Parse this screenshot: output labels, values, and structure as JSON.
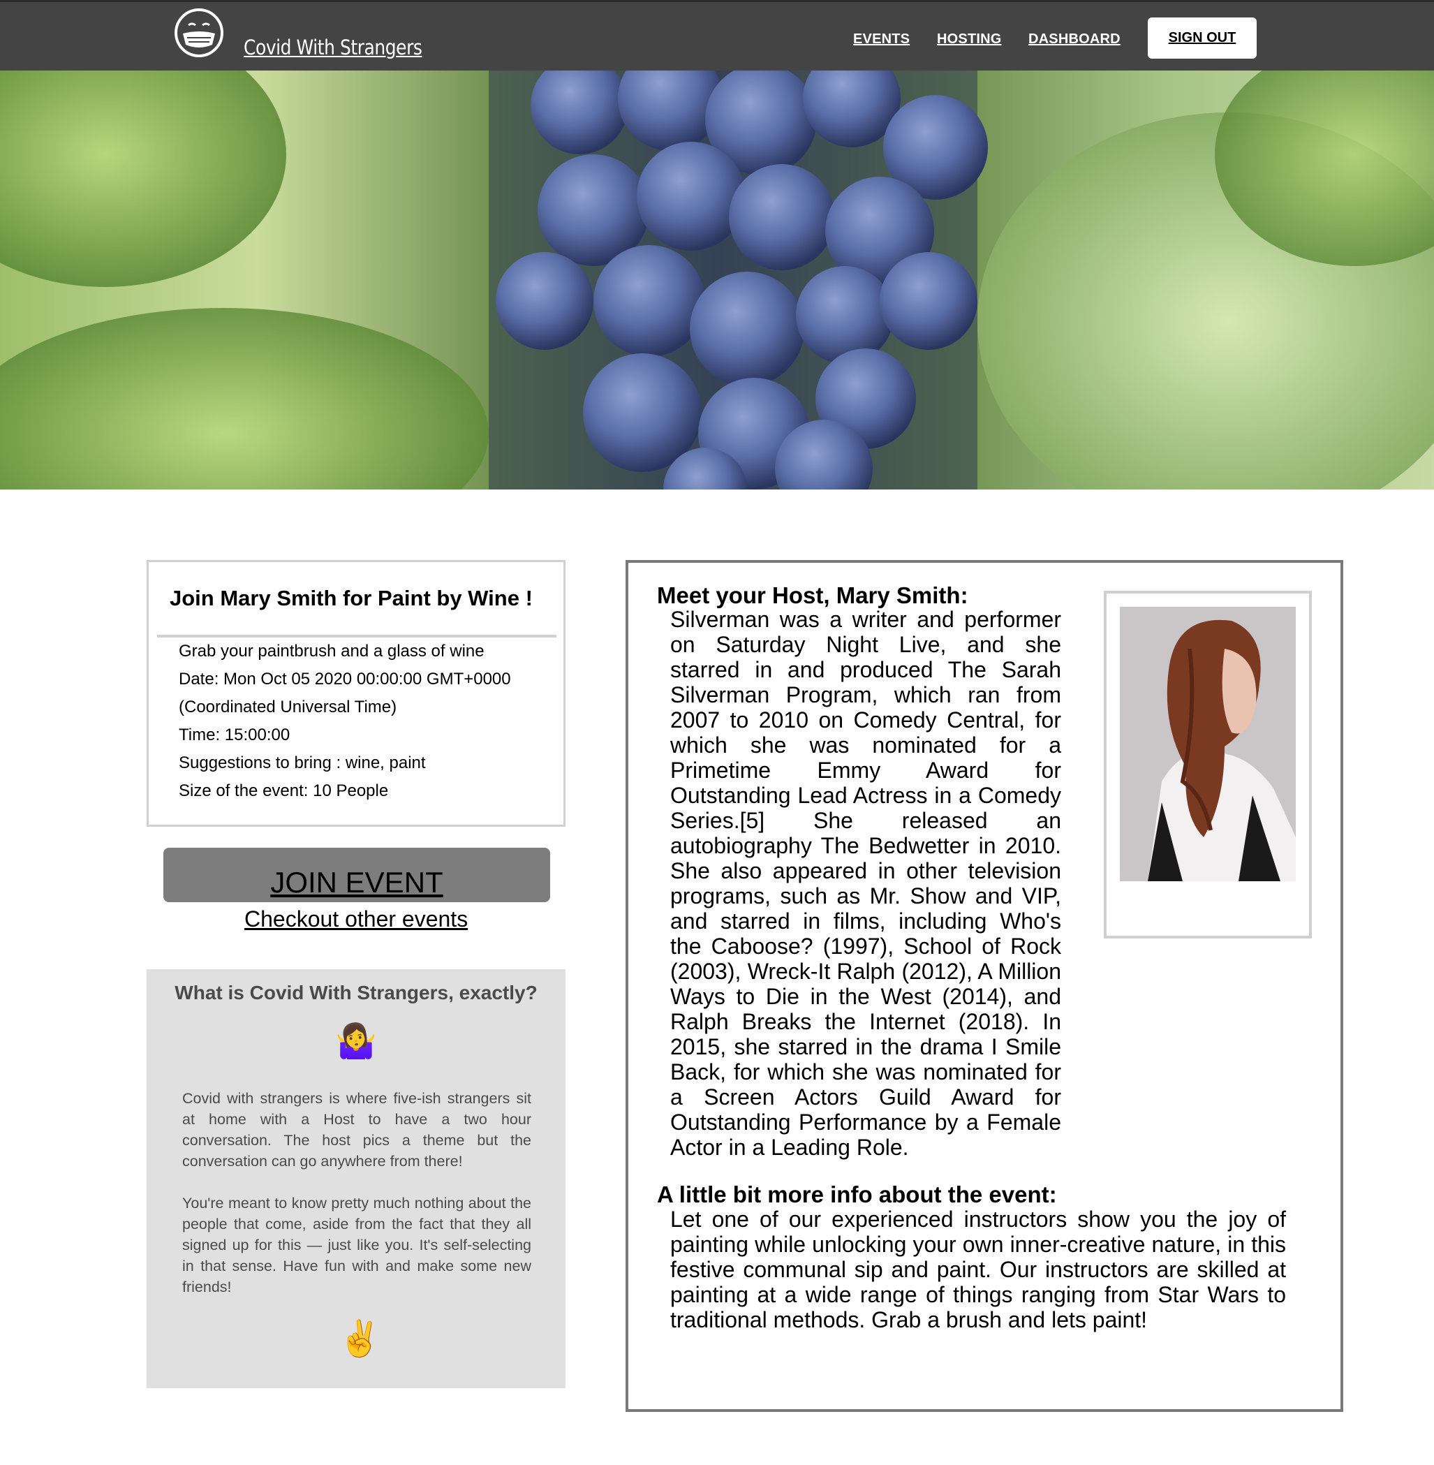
{
  "nav": {
    "brand": "Covid With Strangers",
    "links": [
      "EVENTS",
      "HOSTING",
      "DASHBOARD"
    ],
    "signout": "SIGN OUT"
  },
  "event": {
    "title": "Join Mary Smith for Paint by Wine !",
    "description": "Grab your paintbrush and a glass of wine",
    "date_line1": "Date: Mon Oct 05 2020 00:00:00 GMT+0000",
    "date_line2": "(Coordinated Universal Time)",
    "time": "Time: 15:00:00",
    "suggestions": "Suggestions to bring : wine, paint",
    "size": "Size of the event: 10 People",
    "join_label": "JOIN EVENT",
    "checkout_label": "Checkout other events"
  },
  "about": {
    "title": "What is Covid With Strangers, exactly?",
    "emoji_top": "🤷‍♀️",
    "para1": "Covid with strangers is where five-ish strangers sit at home with a Host to have a two hour conversation. The host pics a theme but the conversation can go anywhere from there!",
    "para2": "You're meant to know pretty much nothing about the people that come, aside from the fact that they all signed up for this — just like you. It's self-selecting in that sense. Have fun with and make some new friends!",
    "emoji_bottom": "✌️"
  },
  "host": {
    "heading": "Meet your Host, Mary Smith:",
    "bio": "Silverman was a writer and performer on Saturday Night Live, and she starred in and produced The Sarah Silverman Program, which ran from 2007 to 2010 on Comedy Central, for which she was nominated for a Primetime Emmy Award for Outstanding Lead Actress in a Comedy Series.[5] She released an autobiography The Bedwetter in 2010. She also appeared in other television programs, such as Mr. Show and VIP, and starred in films, including Who's the Caboose? (1997), School of Rock (2003), Wreck-It Ralph (2012), A Million Ways to Die in the West (2014), and Ralph Breaks the Internet (2018). In 2015, she starred in the drama I Smile Back, for which she was nominated for a Screen Actors Guild Award for Outstanding Performance by a Female Actor in a Leading Role.",
    "info_heading": "A little bit more info about the event:",
    "info_text": "Let one of our experienced instructors show you the joy of painting while unlocking your own inner-creative nature, in this festive communal sip and paint. Our instructors are skilled at painting at a wide range of things ranging from Star Wars to traditional methods. Grab a brush and lets paint!"
  },
  "colors": {
    "navbar": "#444444",
    "join_button": "#7d7d7d",
    "about_box": "#e0e0e0"
  }
}
